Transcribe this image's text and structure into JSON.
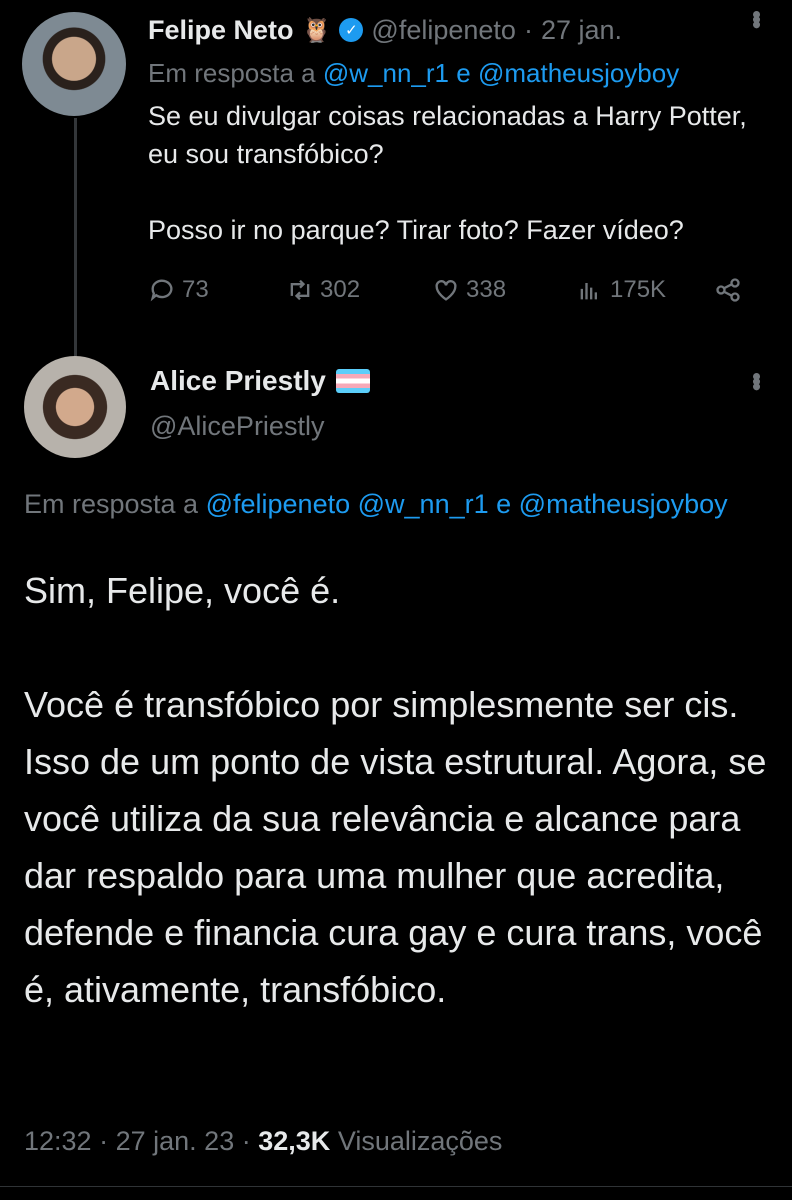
{
  "tweet1": {
    "name": "Felipe Neto",
    "owl_emoji": "🦉",
    "handle": "@felipeneto",
    "dot": "·",
    "date": "27 jan.",
    "reply_prefix": "Em resposta a",
    "reply_user1": "@w_nn_r1",
    "reply_and": "e",
    "reply_user2": "@matheusjoyboy",
    "text_p1": "Se eu divulgar coisas relacionadas a Harry Potter, eu sou transfóbico?",
    "text_p2": "Posso ir no parque? Tirar foto? Fazer vídeo?",
    "replies": "73",
    "retweets": "302",
    "likes": "338",
    "views": "175K"
  },
  "tweet2": {
    "name": "Alice Priestly",
    "handle": "@AlicePriestly",
    "reply_prefix": "Em resposta a",
    "reply_user1": "@felipeneto",
    "reply_user2": "@w_nn_r1",
    "reply_and": "e",
    "reply_user3": "@matheusjoyboy",
    "text_p1": "Sim, Felipe, você é.",
    "text_p2": "Você é transfóbico por simplesmente ser cis. Isso de um ponto de vista estrutural. Agora, se você utiliza da sua relevância e alcance para dar respaldo para uma mulher que acredita, defende e financia cura gay e cura trans, você é, ativamente, transfóbico.",
    "time": "12:32",
    "dot1": "·",
    "date": "27 jan. 23",
    "dot2": "·",
    "view_count": "32,3K",
    "view_label": "Visualizações"
  },
  "icons": [
    "verified-badge-icon",
    "more-icon",
    "reply-icon",
    "retweet-icon",
    "like-icon",
    "views-icon",
    "share-icon",
    "trans-flag-icon"
  ],
  "colors": {
    "background": "#000000",
    "text": "#e7e9ea",
    "muted": "#71767b",
    "link": "#1d9bf0"
  }
}
